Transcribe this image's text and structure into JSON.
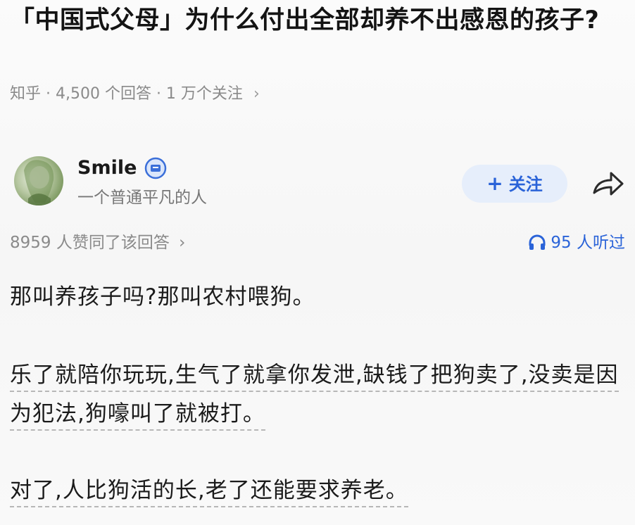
{
  "question": {
    "title": "「中国式父母」为什么付出全部却养不出感恩的孩子?",
    "meta": "知乎 · 4,500 个回答 · 1 万个关注",
    "meta_chevron": "›"
  },
  "author": {
    "name": "Smile",
    "bio": "一个普通平凡的人",
    "follow_label": "关注",
    "follow_plus": "+"
  },
  "answer_stats": {
    "agree_text": "8959 人赞同了该回答",
    "agree_chevron": "›",
    "listen_text": "95 人听过"
  },
  "answer_body": {
    "p1": "那叫养孩子吗?那叫农村喂狗。",
    "p2": "乐了就陪你玩玩,生气了就拿你发泄,缺钱了把狗卖了,没卖是因为犯法,狗嚎叫了就被打。",
    "p3": "对了,人比狗活的长,老了还能要求养老。"
  },
  "colors": {
    "accent": "#2a63d8",
    "follow_bg": "#e6eefb",
    "meta_text": "#8a8a8a"
  },
  "icons": {
    "badge": "verified-badge-icon",
    "share": "share-arrow-icon",
    "headphones": "headphones-icon"
  }
}
